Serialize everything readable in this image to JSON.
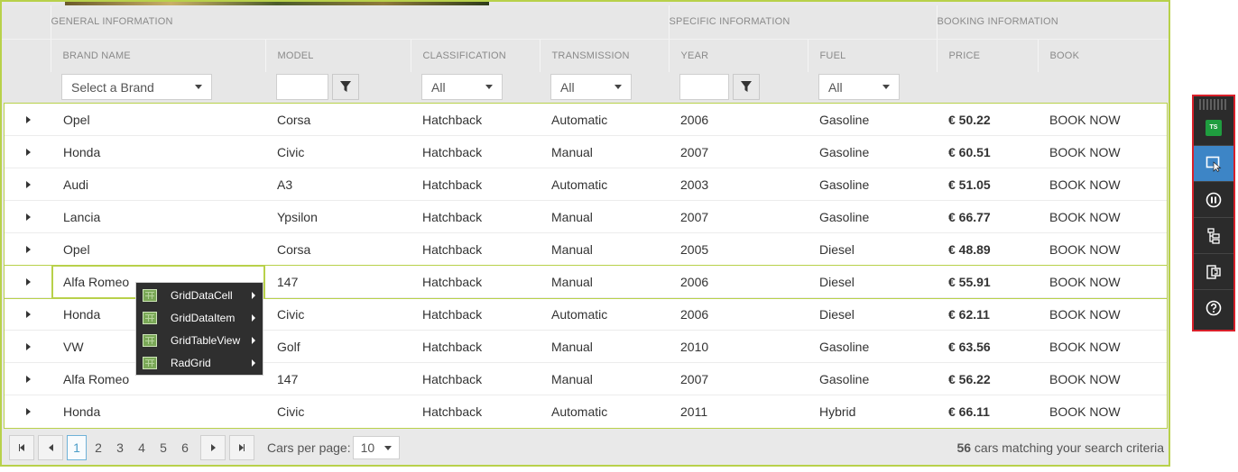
{
  "grid": {
    "groups": [
      "GENERAL INFORMATION",
      "SPECIFIC INFORMATION",
      "BOOKING INFORMATION"
    ],
    "columns": [
      "BRAND NAME",
      "MODEL",
      "CLASSIFICATION",
      "TRANSMISSION",
      "YEAR",
      "FUEL",
      "PRICE",
      "BOOK"
    ],
    "filters": {
      "brand": "Select a Brand",
      "classification": "All",
      "transmission": "All",
      "fuel": "All"
    },
    "rows": [
      {
        "brand": "Opel",
        "model": "Corsa",
        "classification": "Hatchback",
        "transmission": "Automatic",
        "year": "2006",
        "fuel": "Gasoline",
        "price": "€ 50.22",
        "book": "BOOK NOW"
      },
      {
        "brand": "Honda",
        "model": "Civic",
        "classification": "Hatchback",
        "transmission": "Manual",
        "year": "2007",
        "fuel": "Gasoline",
        "price": "€ 60.51",
        "book": "BOOK NOW"
      },
      {
        "brand": "Audi",
        "model": "A3",
        "classification": "Hatchback",
        "transmission": "Automatic",
        "year": "2003",
        "fuel": "Gasoline",
        "price": "€ 51.05",
        "book": "BOOK NOW"
      },
      {
        "brand": "Lancia",
        "model": "Ypsilon",
        "classification": "Hatchback",
        "transmission": "Manual",
        "year": "2007",
        "fuel": "Gasoline",
        "price": "€ 66.77",
        "book": "BOOK NOW"
      },
      {
        "brand": "Opel",
        "model": "Corsa",
        "classification": "Hatchback",
        "transmission": "Manual",
        "year": "2005",
        "fuel": "Diesel",
        "price": "€ 48.89",
        "book": "BOOK NOW"
      },
      {
        "brand": "Alfa Romeo",
        "model": "147",
        "classification": "Hatchback",
        "transmission": "Manual",
        "year": "2006",
        "fuel": "Diesel",
        "price": "€ 55.91",
        "book": "BOOK NOW"
      },
      {
        "brand": "Honda",
        "model": "Civic",
        "classification": "Hatchback",
        "transmission": "Automatic",
        "year": "2006",
        "fuel": "Diesel",
        "price": "€ 62.11",
        "book": "BOOK NOW"
      },
      {
        "brand": "VW",
        "model": "Golf",
        "classification": "Hatchback",
        "transmission": "Manual",
        "year": "2010",
        "fuel": "Gasoline",
        "price": "€ 63.56",
        "book": "BOOK NOW"
      },
      {
        "brand": "Alfa Romeo",
        "model": "147",
        "classification": "Hatchback",
        "transmission": "Manual",
        "year": "2007",
        "fuel": "Gasoline",
        "price": "€ 56.22",
        "book": "BOOK NOW"
      },
      {
        "brand": "Honda",
        "model": "Civic",
        "classification": "Hatchback",
        "transmission": "Automatic",
        "year": "2011",
        "fuel": "Hybrid",
        "price": "€ 66.11",
        "book": "BOOK NOW"
      }
    ]
  },
  "pager": {
    "pages": [
      "1",
      "2",
      "3",
      "4",
      "5",
      "6"
    ],
    "current_page": "1",
    "per_page_label": "Cars per page:",
    "per_page_value": "10",
    "total_count": "56",
    "total_suffix": "cars matching your search criteria"
  },
  "context_menu": {
    "items": [
      "GridDataCell",
      "GridDataItem",
      "GridTableView",
      "RadGrid"
    ]
  },
  "toolbar": {
    "logo_text": "TS",
    "buttons": [
      "ts-logo-icon",
      "element-select-icon",
      "pause-icon",
      "tree-view-icon",
      "translator-icon",
      "help-icon"
    ],
    "accent": "#3d85c6",
    "border": "#d9202a"
  },
  "colors": {
    "highlight": "#b8d14a",
    "pager_current": "#4a9cc7"
  }
}
